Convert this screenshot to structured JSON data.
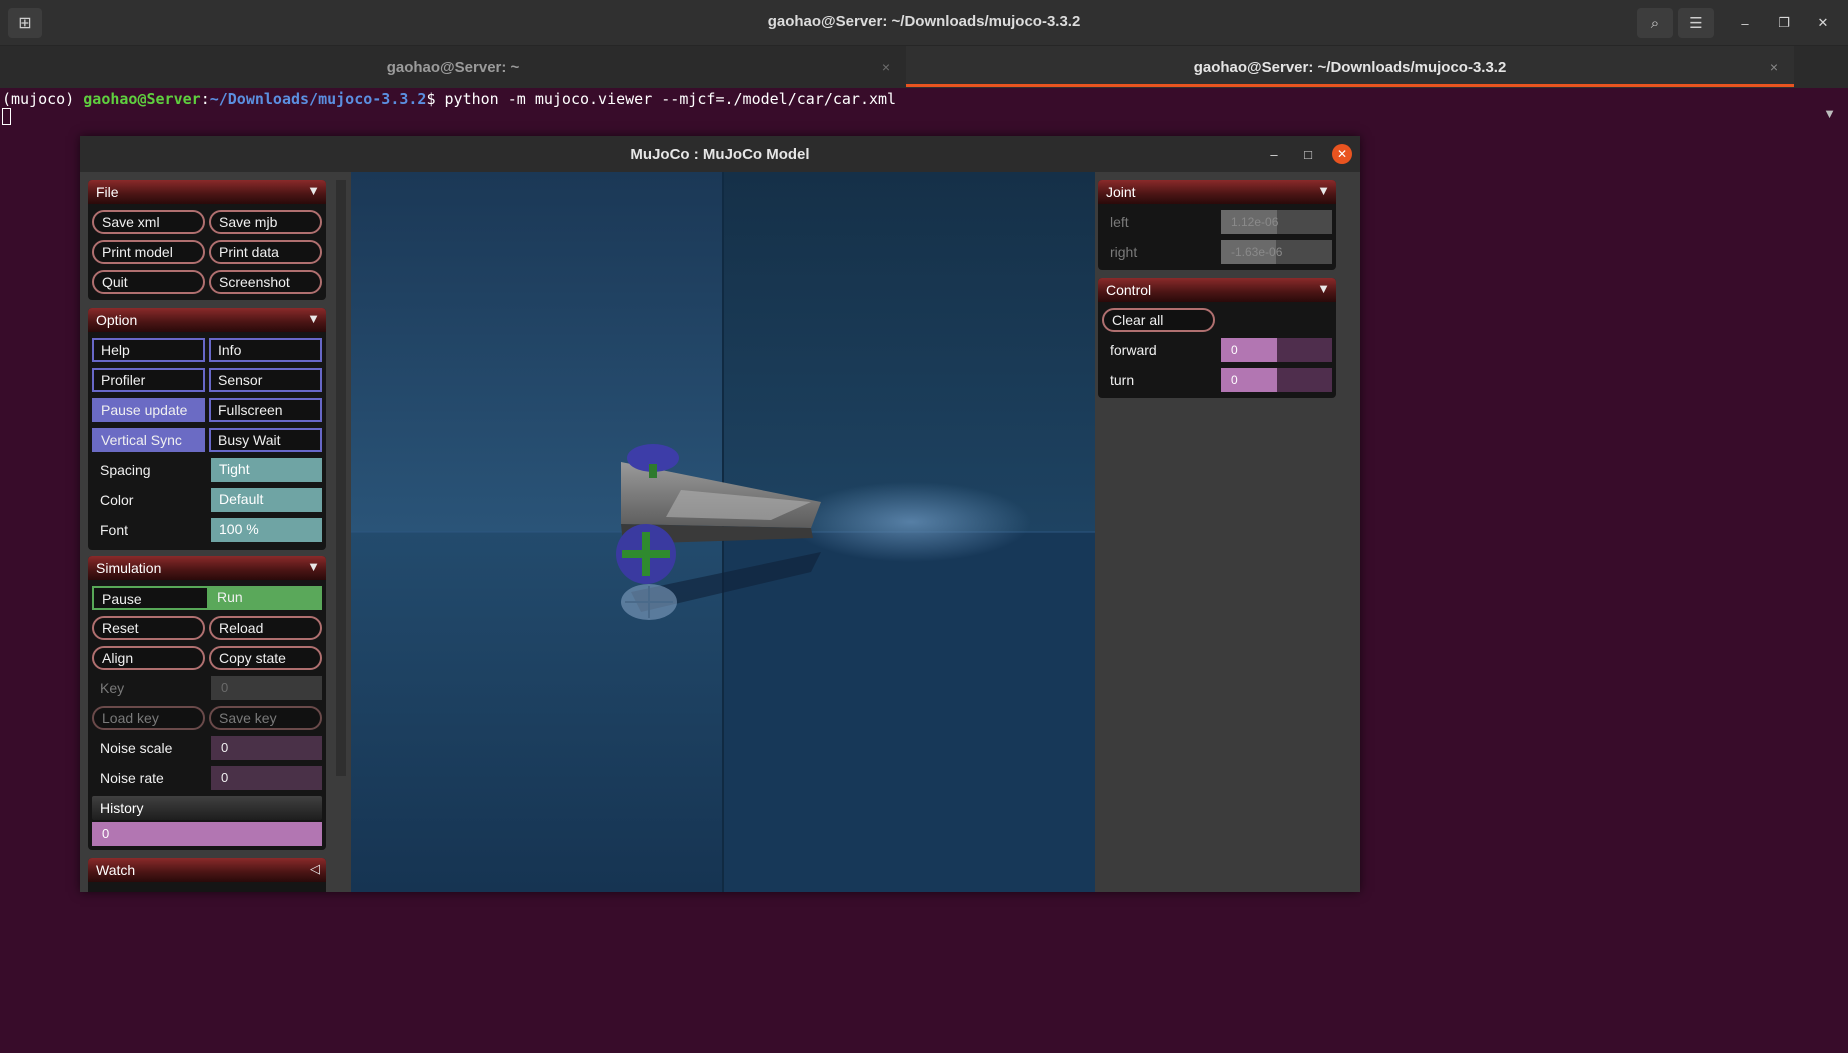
{
  "terminal": {
    "title": "gaohao@Server: ~/Downloads/mujoco-3.3.2",
    "tabs": [
      {
        "label": "gaohao@Server: ~",
        "close": "×"
      },
      {
        "label": "gaohao@Server: ~/Downloads/mujoco-3.3.2",
        "close": "×"
      }
    ],
    "prompt_env": "(mujoco) ",
    "prompt_user": "gaohao@Server",
    "prompt_sep": ":",
    "prompt_path": "~/Downloads/mujoco-3.3.2",
    "prompt_end": "$ ",
    "command": "python -m mujoco.viewer --mjcf=./model/car/car.xml"
  },
  "mujoco": {
    "title": "MuJoCo : MuJoCo Model",
    "file": {
      "header": "File",
      "buttons": [
        "Save xml",
        "Save mjb",
        "Print model",
        "Print data",
        "Quit",
        "Screenshot"
      ]
    },
    "option": {
      "header": "Option",
      "toggles": [
        "Help",
        "Info",
        "Profiler",
        "Sensor",
        "Pause update",
        "Fullscreen",
        "Vertical Sync",
        "Busy Wait"
      ],
      "spacing_label": "Spacing",
      "spacing_value": "Tight",
      "color_label": "Color",
      "color_value": "Default",
      "font_label": "Font",
      "font_value": "100 %"
    },
    "simulation": {
      "header": "Simulation",
      "pause": "Pause",
      "run": "Run",
      "reset": "Reset",
      "reload": "Reload",
      "align": "Align",
      "copy_state": "Copy state",
      "key_label": "Key",
      "key_value": "0",
      "load_key": "Load key",
      "save_key": "Save key",
      "noise_scale_label": "Noise scale",
      "noise_scale_value": "0",
      "noise_rate_label": "Noise rate",
      "noise_rate_value": "0",
      "history_label": "History",
      "history_value": "0"
    },
    "watch": {
      "header": "Watch"
    },
    "joint": {
      "header": "Joint",
      "left_label": "left",
      "left_value": "1.12e-06",
      "right_label": "right",
      "right_value": "-1.63e-06"
    },
    "control": {
      "header": "Control",
      "clear_all": "Clear all",
      "forward_label": "forward",
      "forward_value": "0",
      "turn_label": "turn",
      "turn_value": "0"
    }
  }
}
